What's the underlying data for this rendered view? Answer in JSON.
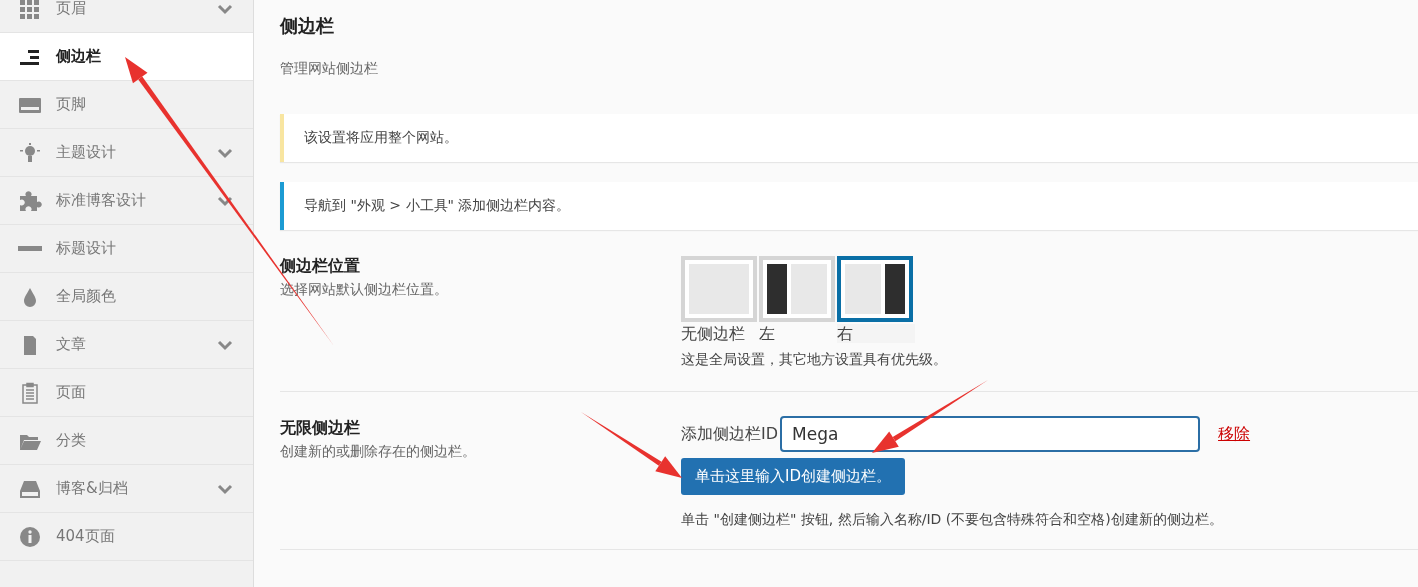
{
  "sidebar": {
    "items": [
      {
        "label": "页眉",
        "expandable": true,
        "selected": false
      },
      {
        "label": "侧边栏",
        "expandable": false,
        "selected": true
      },
      {
        "label": "页脚",
        "expandable": false,
        "selected": false
      },
      {
        "label": "主题设计",
        "expandable": true,
        "selected": false
      },
      {
        "label": "标准博客设计",
        "expandable": true,
        "selected": false
      },
      {
        "label": "标题设计",
        "expandable": false,
        "selected": false
      },
      {
        "label": "全局颜色",
        "expandable": false,
        "selected": false
      },
      {
        "label": "文章",
        "expandable": true,
        "selected": false
      },
      {
        "label": "页面",
        "expandable": false,
        "selected": false
      },
      {
        "label": "分类",
        "expandable": false,
        "selected": false
      },
      {
        "label": "博客&归档",
        "expandable": true,
        "selected": false
      },
      {
        "label": "404页面",
        "expandable": false,
        "selected": false
      }
    ]
  },
  "page": {
    "title": "侧边栏",
    "subtitle": "管理网站侧边栏"
  },
  "notices": [
    {
      "kind": "warning",
      "text": "该设置将应用整个网站。"
    },
    {
      "kind": "info",
      "text": "导航到 \"外观 > 小工具\" 添加侧边栏内容。"
    }
  ],
  "settings": [
    {
      "kind": "layout",
      "title": "侧边栏位置",
      "description": "选择网站默认侧边栏位置。",
      "options": [
        {
          "label": "无侧边栏",
          "kind": "none",
          "selected": false
        },
        {
          "label": "左",
          "kind": "left",
          "selected": false
        },
        {
          "label": "右",
          "kind": "right",
          "selected": true
        }
      ],
      "note": "这是全局设置，其它地方设置具有优先级。"
    },
    {
      "kind": "sidebars",
      "title": "无限侧边栏",
      "description": "创建新的或删除存在的侧边栏。",
      "field_label": "添加侧边栏ID",
      "value": "Mega",
      "remove_link": "移除",
      "button": "单击这里输入ID创建侧边栏。",
      "note": "单击 \"创建侧边栏\" 按钮, 然后输入名称/ID (不要包含特殊符合和空格)创建新的侧边栏。"
    }
  ]
}
